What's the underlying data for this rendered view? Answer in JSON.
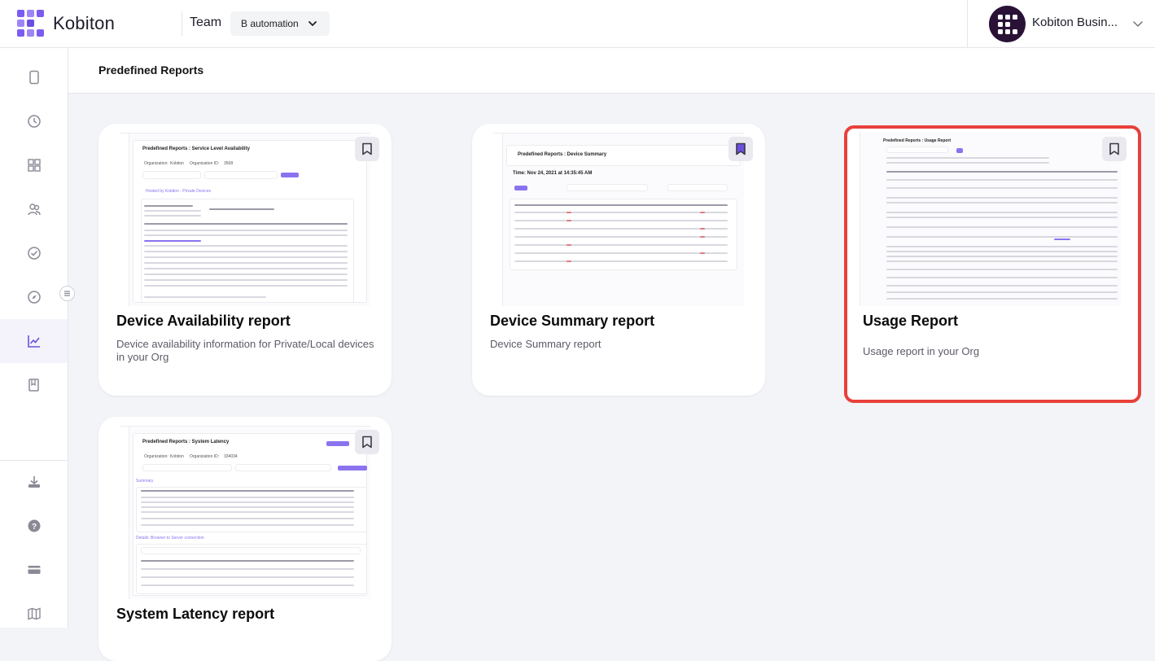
{
  "app": {
    "brand": "Kobiton",
    "team_label": "Team",
    "team_selected": "B automation",
    "org_name": "Kobiton Busin..."
  },
  "page": {
    "title": "Predefined Reports"
  },
  "reports": [
    {
      "title": "Device Availability report",
      "description": "Device availability information for Private/Local devices in your Org",
      "thumbnail": {
        "heading": "Predefined Reports : Service Level Availability",
        "org_label": "Organization:",
        "org_value": "Kobiton",
        "org_id_label": "Organization ID:",
        "org_id_value": "3568",
        "section": "Hosted by Kobiton - Private Devices"
      }
    },
    {
      "title": "Device Summary report",
      "description": "Device Summary report",
      "thumbnail": {
        "heading": "Predefined Reports : Device Summary",
        "time": "Time: Nov 24, 2021 at 14:35:45 AM"
      }
    },
    {
      "title": "Usage Report",
      "description": "Usage report in your Org",
      "highlighted": true,
      "thumbnail": {
        "heading": "Predefined Reports : Usage Report"
      }
    },
    {
      "title": "System Latency report",
      "description": "",
      "thumbnail": {
        "heading": "Predefined Reports : System Latency",
        "org_label": "Organization:",
        "org_value": "Kobiton",
        "org_id_label": "Organization ID:",
        "org_id_value": "334034",
        "section_1": "Summary",
        "section_2": "Details: Browser to Server connection"
      }
    }
  ],
  "sidebar": {
    "items": [
      {
        "icon": "phone-icon"
      },
      {
        "icon": "clock-icon"
      },
      {
        "icon": "grid-icon"
      },
      {
        "icon": "users-icon"
      },
      {
        "icon": "check-circle-icon"
      },
      {
        "icon": "compass-icon"
      },
      {
        "icon": "chart-icon",
        "active": true
      },
      {
        "icon": "bookmark-book-icon"
      },
      {
        "icon": "download-icon"
      },
      {
        "icon": "help-icon"
      },
      {
        "icon": "card-icon"
      },
      {
        "icon": "map-icon"
      }
    ]
  },
  "colors": {
    "accent": "#6b4fe0",
    "highlight": "#e8403a",
    "background": "#f3f4f8"
  }
}
